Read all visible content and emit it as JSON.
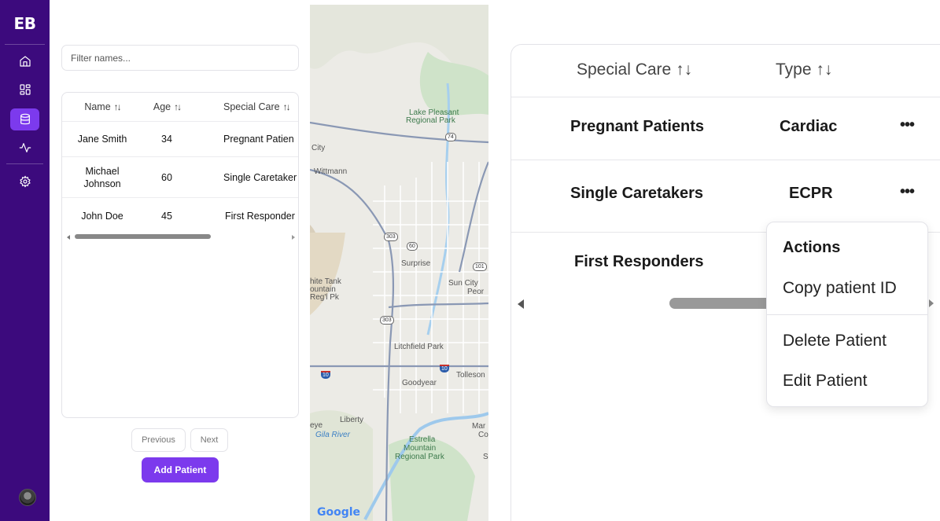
{
  "sidebar": {
    "logo": "EB",
    "nav": [
      {
        "icon": "home-icon"
      },
      {
        "icon": "dashboard-icon"
      },
      {
        "icon": "database-icon",
        "active": true
      },
      {
        "icon": "activity-icon"
      },
      {
        "icon": "settings-icon"
      }
    ],
    "accent": "#7c3aed",
    "background": "#3c0a7d"
  },
  "filter": {
    "placeholder": "Filter names..."
  },
  "table": {
    "columns": [
      "Name",
      "Age",
      "Special Care"
    ],
    "sort_icon": "↑↓",
    "rows": [
      {
        "name": "Jane Smith",
        "age": "34",
        "special_care": "Pregnant Patien"
      },
      {
        "name": "Michael Johnson",
        "age": "60",
        "special_care": "Single Caretaker"
      },
      {
        "name": "John Doe",
        "age": "45",
        "special_care": "First Responder"
      }
    ]
  },
  "pagination": {
    "previous": "Previous",
    "next": "Next"
  },
  "add_button": "Add Patient",
  "map": {
    "labels": {
      "lake_pleasant": "Lake Pleasant",
      "regional_park": "Regional Park",
      "city": "City",
      "wittmann": "Wittmann",
      "surprise": "Surprise",
      "sun_city": "Sun City",
      "peoria": "Peor",
      "white_tank_1": "hite Tank",
      "white_tank_2": "ountain",
      "white_tank_3": "Reg'l Pk",
      "litchfield": "Litchfield Park",
      "tolleson": "Tolleson",
      "goodyear": "Goodyear",
      "liberty": "Liberty",
      "gila_river": "Gila River",
      "eye": "eye",
      "mar": "Mar",
      "co": "Co",
      "estrella_1": "Estrella",
      "estrella_2": "Mountain",
      "estrella_3": "Regional Park",
      "s": "S"
    },
    "shields": {
      "r74": "74",
      "r303a": "303",
      "r60": "60",
      "r101": "101",
      "r303b": "303",
      "i10a": "10",
      "i10b": "10"
    },
    "brand": "Google"
  },
  "zoomed": {
    "columns": [
      "Special Care",
      "Type"
    ],
    "sort_icon": "↑↓",
    "rows": [
      {
        "special_care": "Pregnant Patients",
        "type": "Cardiac"
      },
      {
        "special_care": "Single Caretakers",
        "type": "ECPR"
      },
      {
        "special_care": "First Responders",
        "type": ""
      }
    ],
    "more_icon": "•••"
  },
  "menu": {
    "title": "Actions",
    "items": [
      "Copy patient ID",
      "Delete Patient",
      "Edit Patient"
    ]
  }
}
